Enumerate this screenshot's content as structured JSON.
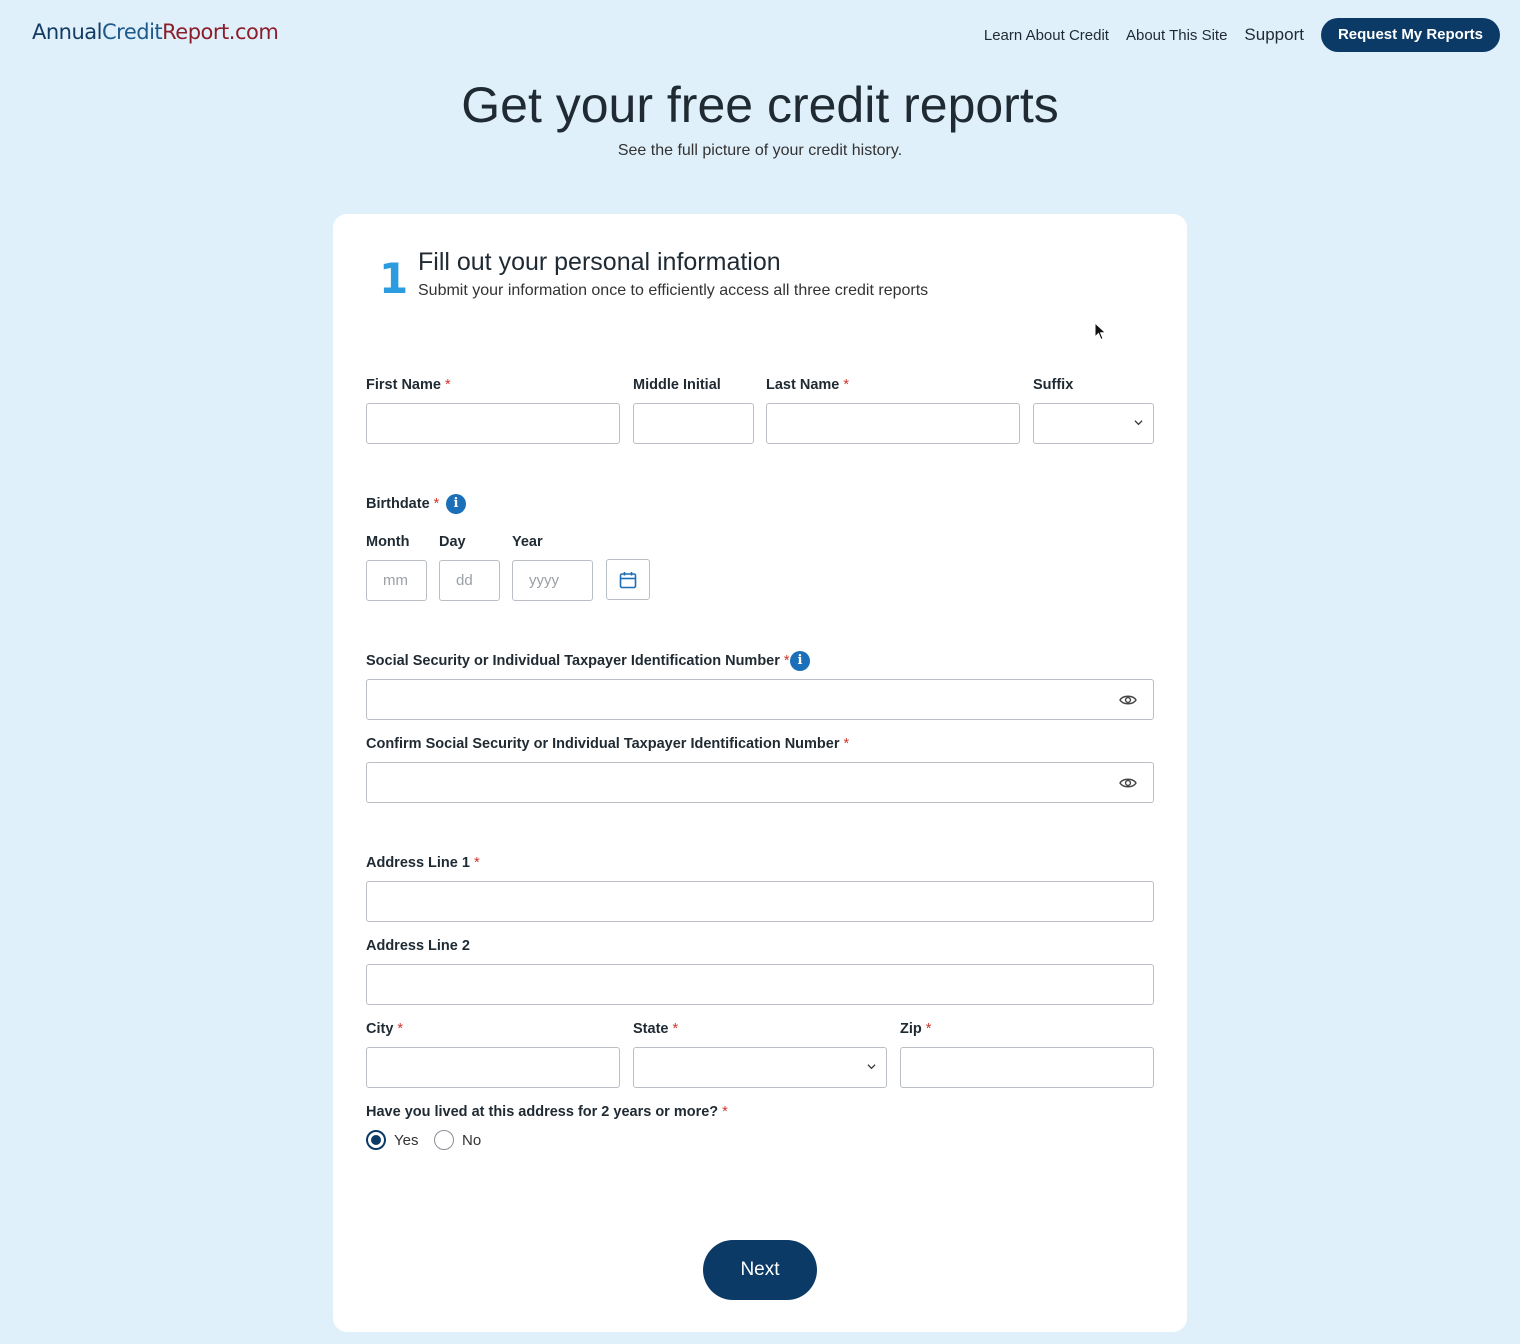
{
  "header": {
    "logo": {
      "part1": "Annual",
      "part2": "Credit",
      "part3": "Report.com"
    },
    "nav": {
      "learn": "Learn About Credit",
      "about": "About This Site",
      "support": "Support",
      "cta": "Request My Reports"
    }
  },
  "hero": {
    "title": "Get your free credit reports",
    "subtitle": "See the full picture of your credit history."
  },
  "step": {
    "number": "1",
    "title": "Fill out your personal information",
    "subtitle": "Submit your information once to efficiently access all three credit reports"
  },
  "form": {
    "required_mark": "*",
    "first_name": {
      "label": "First Name",
      "value": ""
    },
    "middle_initial": {
      "label": "Middle Initial",
      "value": ""
    },
    "last_name": {
      "label": "Last Name",
      "value": ""
    },
    "suffix": {
      "label": "Suffix",
      "value": ""
    },
    "birthdate": {
      "label": "Birthdate",
      "info": "i",
      "month": {
        "label": "Month",
        "placeholder": "mm"
      },
      "day": {
        "label": "Day",
        "placeholder": "dd"
      },
      "year": {
        "label": "Year",
        "placeholder": "yyyy"
      }
    },
    "ssn": {
      "label": "Social Security or Individual Taxpayer Identification Number",
      "info": "i",
      "value": ""
    },
    "ssn_confirm": {
      "label": "Confirm Social Security or Individual Taxpayer Identification Number",
      "value": ""
    },
    "address1": {
      "label": "Address Line 1",
      "value": ""
    },
    "address2": {
      "label": "Address Line 2",
      "value": ""
    },
    "city": {
      "label": "City",
      "value": ""
    },
    "state": {
      "label": "State",
      "value": ""
    },
    "zip": {
      "label": "Zip",
      "value": ""
    },
    "lived_two_years": {
      "question": "Have you lived at this address for 2 years or more?",
      "options": [
        "Yes",
        "No"
      ],
      "selected": "Yes"
    },
    "next_label": "Next"
  },
  "colors": {
    "page_bg": "#dff0fb",
    "primary": "#0c3a66",
    "step_number": "#2c9be0",
    "info_icon": "#1a6fb8",
    "required": "#d0342c",
    "logo_dark": "#123a63",
    "logo_red": "#8a1f2b"
  },
  "icons": [
    "info-icon",
    "eye-icon",
    "calendar-icon",
    "chevron-down-icon",
    "mouse-cursor-icon"
  ]
}
